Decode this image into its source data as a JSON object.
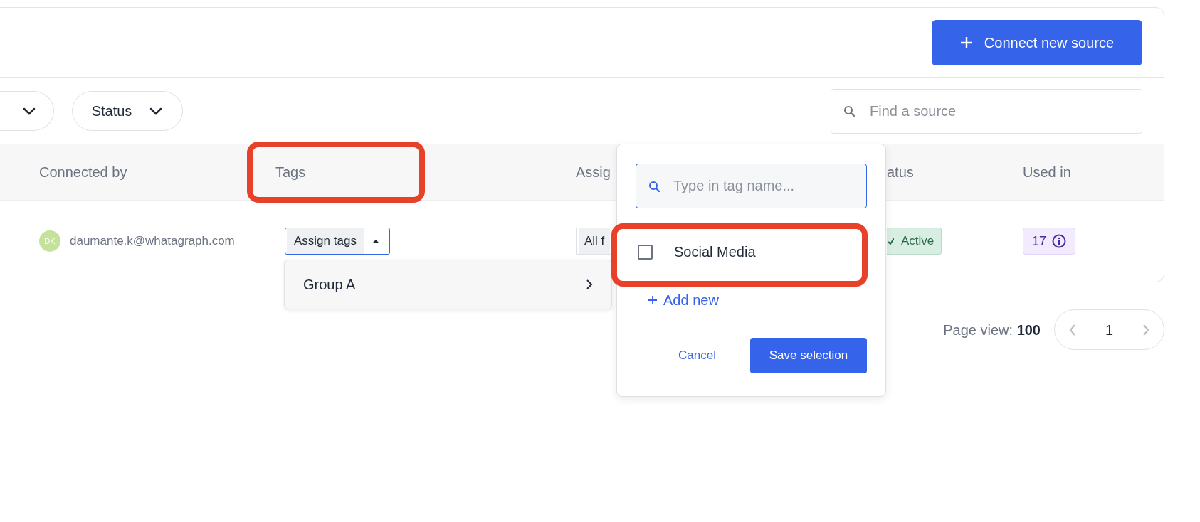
{
  "header": {
    "connect_button": "Connect new source"
  },
  "filters": [
    {
      "kind": "cut"
    },
    {
      "kind": "pill",
      "label": "Status"
    }
  ],
  "search": {
    "placeholder": "Find a source"
  },
  "table": {
    "columns": [
      {
        "label": "Connected by",
        "highlighted": false
      },
      {
        "label": "Tags",
        "highlighted": true
      },
      {
        "label": "Assig",
        "highlighted": false
      },
      {
        "label": "atus",
        "highlighted": false
      },
      {
        "label": "Used in",
        "highlighted": false
      }
    ],
    "rows": [
      {
        "avatar": "DK",
        "email": "daumante.k@whatagraph.com",
        "tags_button": "Assign tags",
        "tags_expanded": true,
        "assigned": "All f",
        "status": "Active",
        "used_in": "17"
      }
    ]
  },
  "tag_menu": {
    "items": [
      {
        "label": "Group A"
      }
    ]
  },
  "tag_popover": {
    "search_placeholder": "Type in tag name...",
    "tags": [
      {
        "label": "Social Media",
        "checked": false,
        "highlighted": true
      }
    ],
    "add_new": "Add new",
    "cancel": "Cancel",
    "save": "Save selection"
  },
  "pagination": {
    "page_view_label": "Page view:",
    "page_view_value": "100",
    "page": "1"
  }
}
